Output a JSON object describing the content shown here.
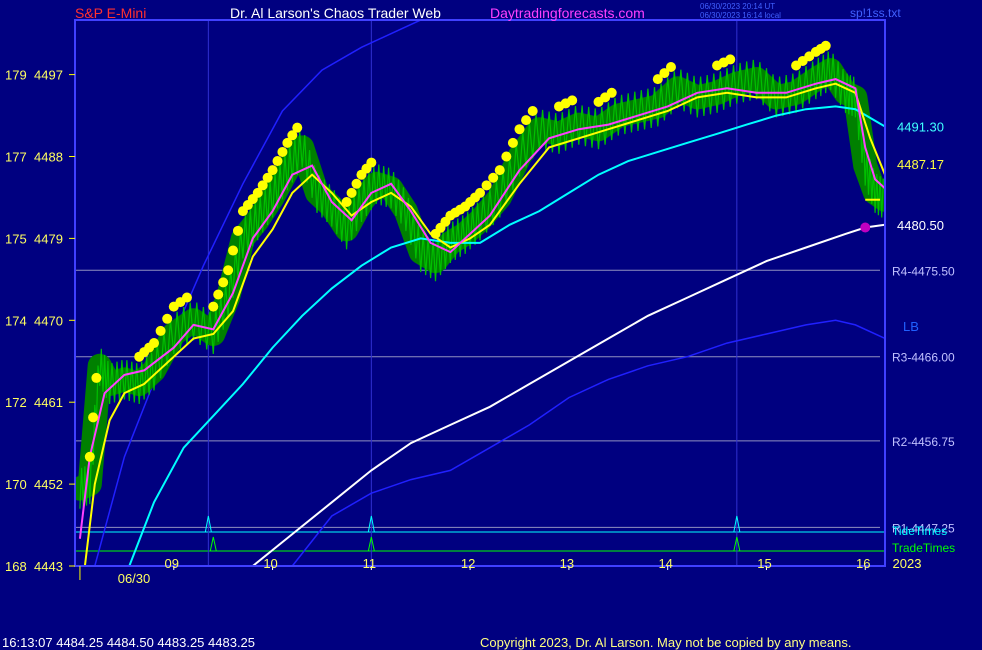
{
  "header": {
    "left": "S&P E-Mini",
    "center": "Dr. Al Larson's Chaos Trader Web",
    "site": "Daytradingforecasts.com",
    "stamp1": "06/30/2023 20:14 UT",
    "stamp2": "06/30/2023 16:14 local",
    "right": "sp!1ss.txt"
  },
  "footer": {
    "quote": "16:13:07  4484.25 4484.50 4483.25 4483.25",
    "copyright": "Copyright 2023, Dr. Al Larson. May not be copied by any means."
  },
  "colors": {
    "background": "#000080",
    "frame": "#4040ff",
    "price": "#00c000",
    "glow": "#008000",
    "ma_fast": "#ff40ff",
    "ma_slow": "#ffff00",
    "ma_cyan": "#00ffff",
    "ma_white": "#ffffff",
    "band": "#2020ff",
    "dots": "#ffff00",
    "pivot": "#c000c0"
  },
  "chart_data": {
    "type": "line",
    "title": "S&P E-Mini",
    "ylim": [
      4443,
      4503
    ],
    "y_ticks": [
      {
        "left": "168",
        "right": "4443",
        "value": 4443
      },
      {
        "left": "170",
        "right": "4452",
        "value": 4452
      },
      {
        "left": "172",
        "right": "4461",
        "value": 4461
      },
      {
        "left": "174",
        "right": "4470",
        "value": 4470
      },
      {
        "left": "175",
        "right": "4479",
        "value": 4479
      },
      {
        "left": "177",
        "right": "4488",
        "value": 4488
      },
      {
        "left": "179",
        "right": "4497",
        "value": 4497
      }
    ],
    "xlim": [
      8.0,
      16.2
    ],
    "x_ticks": [
      {
        "label": "09",
        "value": 9
      },
      {
        "label": "10",
        "value": 10
      },
      {
        "label": "11",
        "value": 11
      },
      {
        "label": "12",
        "value": 12
      },
      {
        "label": "13",
        "value": 13
      },
      {
        "label": "14",
        "value": 14
      },
      {
        "label": "15",
        "value": 15
      },
      {
        "label": "16",
        "value": 16
      }
    ],
    "date_label": "06/30",
    "year_label": "2023",
    "levels": [
      {
        "label": "R4-4475.50",
        "value": 4475.5
      },
      {
        "label": "R3-4466.00",
        "value": 4466.0
      },
      {
        "label": "R2-4456.75",
        "value": 4456.75
      },
      {
        "label": "R1-4447.25",
        "value": 4447.25
      }
    ],
    "value_labels": [
      {
        "label": "4491.30",
        "value": 4491.3,
        "series": "ma_cyan"
      },
      {
        "label": "4487.17",
        "value": 4487.17,
        "series": "ma_slow"
      },
      {
        "label": "4480.50",
        "value": 4480.5,
        "series": "ma_white"
      }
    ],
    "band_label": "LB",
    "legend": [
      "TideTimes",
      "TradeTimes"
    ],
    "tide_times": [
      9.35,
      11.0,
      14.7
    ],
    "trade_times": [
      9.4,
      11.0,
      14.7
    ],
    "price": {
      "x": [
        8.05,
        8.15,
        8.25,
        8.35,
        8.5,
        8.65,
        8.8,
        9.0,
        9.2,
        9.4,
        9.55,
        9.7,
        9.85,
        10.0,
        10.15,
        10.3,
        10.45,
        10.6,
        10.75,
        10.9,
        11.05,
        11.2,
        11.35,
        11.5,
        11.65,
        11.8,
        11.95,
        12.1,
        12.3,
        12.5,
        12.7,
        12.9,
        13.1,
        13.3,
        13.5,
        13.7,
        13.9,
        14.1,
        14.3,
        14.5,
        14.7,
        14.9,
        15.1,
        15.3,
        15.5,
        15.65,
        15.8,
        15.9,
        16.0,
        16.1,
        16.2
      ],
      "y": [
        4451.5,
        4452.0,
        4465.0,
        4463.0,
        4463.5,
        4463.0,
        4464.5,
        4468.5,
        4470.0,
        4468.5,
        4472.5,
        4479.0,
        4481.0,
        4483.5,
        4486.5,
        4489.0,
        4484.0,
        4482.5,
        4480.0,
        4483.0,
        4485.0,
        4484.5,
        4482.0,
        4477.5,
        4476.5,
        4478.5,
        4479.5,
        4481.0,
        4483.5,
        4488.0,
        4491.0,
        4490.5,
        4491.5,
        4491.0,
        4492.5,
        4493.0,
        4493.5,
        4495.5,
        4494.5,
        4495.0,
        4496.0,
        4496.5,
        4494.5,
        4495.0,
        4496.5,
        4497.5,
        4495.0,
        4494.5,
        4487.0,
        4484.0,
        4483.25
      ]
    },
    "series": [
      {
        "name": "ma_fast",
        "points": [
          [
            8.05,
            4446
          ],
          [
            8.15,
            4455
          ],
          [
            8.3,
            4462
          ],
          [
            8.5,
            4464
          ],
          [
            8.7,
            4464.5
          ],
          [
            9.0,
            4467
          ],
          [
            9.2,
            4469.5
          ],
          [
            9.4,
            4469
          ],
          [
            9.6,
            4473
          ],
          [
            9.8,
            4479
          ],
          [
            10.0,
            4482
          ],
          [
            10.2,
            4486
          ],
          [
            10.4,
            4487
          ],
          [
            10.6,
            4483
          ],
          [
            10.8,
            4481
          ],
          [
            11.0,
            4484
          ],
          [
            11.2,
            4485
          ],
          [
            11.4,
            4482
          ],
          [
            11.6,
            4478.5
          ],
          [
            11.8,
            4477.5
          ],
          [
            12.0,
            4479.5
          ],
          [
            12.2,
            4481.5
          ],
          [
            12.5,
            4486.5
          ],
          [
            12.8,
            4490
          ],
          [
            13.1,
            4491
          ],
          [
            13.4,
            4491.5
          ],
          [
            13.7,
            4492.5
          ],
          [
            14.0,
            4493.5
          ],
          [
            14.3,
            4495
          ],
          [
            14.6,
            4495.5
          ],
          [
            14.9,
            4495
          ],
          [
            15.2,
            4495
          ],
          [
            15.5,
            4496
          ],
          [
            15.7,
            4496.5
          ],
          [
            15.9,
            4495.5
          ],
          [
            16.0,
            4489
          ],
          [
            16.1,
            4485.5
          ],
          [
            16.2,
            4484.5
          ]
        ]
      },
      {
        "name": "ma_slow",
        "points": [
          [
            8.1,
            4443
          ],
          [
            8.2,
            4452
          ],
          [
            8.35,
            4459
          ],
          [
            8.5,
            4462
          ],
          [
            8.7,
            4463
          ],
          [
            9.0,
            4466
          ],
          [
            9.2,
            4468
          ],
          [
            9.4,
            4468.5
          ],
          [
            9.6,
            4471
          ],
          [
            9.8,
            4477
          ],
          [
            10.0,
            4480
          ],
          [
            10.2,
            4484
          ],
          [
            10.4,
            4486
          ],
          [
            10.6,
            4484
          ],
          [
            10.8,
            4481.5
          ],
          [
            11.0,
            4483
          ],
          [
            11.2,
            4484
          ],
          [
            11.4,
            4482.5
          ],
          [
            11.6,
            4479.5
          ],
          [
            11.8,
            4478
          ],
          [
            12.0,
            4479
          ],
          [
            12.2,
            4480.5
          ],
          [
            12.5,
            4485
          ],
          [
            12.8,
            4489
          ],
          [
            13.1,
            4490
          ],
          [
            13.4,
            4491
          ],
          [
            13.7,
            4492
          ],
          [
            14.0,
            4493
          ],
          [
            14.3,
            4494.5
          ],
          [
            14.6,
            4495
          ],
          [
            14.9,
            4494.5
          ],
          [
            15.2,
            4494.5
          ],
          [
            15.5,
            4495.5
          ],
          [
            15.7,
            4496
          ],
          [
            15.9,
            4495
          ],
          [
            16.05,
            4490
          ],
          [
            16.2,
            4486
          ]
        ]
      },
      {
        "name": "ma_cyan",
        "points": [
          [
            8.55,
            4443
          ],
          [
            8.8,
            4450
          ],
          [
            9.1,
            4456
          ],
          [
            9.4,
            4459.5
          ],
          [
            9.7,
            4463
          ],
          [
            10.0,
            4467
          ],
          [
            10.3,
            4470.5
          ],
          [
            10.6,
            4473.5
          ],
          [
            10.9,
            4476
          ],
          [
            11.2,
            4478
          ],
          [
            11.5,
            4479
          ],
          [
            11.8,
            4478.5
          ],
          [
            12.1,
            4478.5
          ],
          [
            12.4,
            4480.5
          ],
          [
            12.7,
            4482
          ],
          [
            13.0,
            4484
          ],
          [
            13.3,
            4486
          ],
          [
            13.6,
            4487.5
          ],
          [
            13.9,
            4488.5
          ],
          [
            14.2,
            4489.5
          ],
          [
            14.5,
            4490.5
          ],
          [
            14.8,
            4491.5
          ],
          [
            15.1,
            4492.5
          ],
          [
            15.4,
            4493.2
          ],
          [
            15.7,
            4493.5
          ],
          [
            15.9,
            4493.2
          ],
          [
            16.2,
            4491.3
          ]
        ]
      },
      {
        "name": "ma_white",
        "points": [
          [
            9.8,
            4443
          ],
          [
            10.2,
            4446.5
          ],
          [
            10.6,
            4450
          ],
          [
            11.0,
            4453.5
          ],
          [
            11.4,
            4456.5
          ],
          [
            11.8,
            4458.5
          ],
          [
            12.2,
            4460.5
          ],
          [
            12.6,
            4463
          ],
          [
            13.0,
            4465.5
          ],
          [
            13.4,
            4468
          ],
          [
            13.8,
            4470.5
          ],
          [
            14.2,
            4472.5
          ],
          [
            14.6,
            4474.5
          ],
          [
            15.0,
            4476.5
          ],
          [
            15.4,
            4478
          ],
          [
            15.8,
            4479.5
          ],
          [
            16.0,
            4480.2
          ],
          [
            16.2,
            4480.5
          ]
        ]
      },
      {
        "name": "band_upper",
        "points": [
          [
            8.2,
            4443
          ],
          [
            8.5,
            4455
          ],
          [
            8.9,
            4466
          ],
          [
            9.3,
            4476
          ],
          [
            9.7,
            4485
          ],
          [
            10.1,
            4493
          ],
          [
            10.5,
            4497.5
          ],
          [
            10.9,
            4500
          ],
          [
            11.3,
            4502
          ],
          [
            11.7,
            4504
          ],
          [
            12.0,
            4504
          ],
          [
            12.3,
            4505
          ],
          [
            12.6,
            4506
          ]
        ]
      },
      {
        "name": "band_lower",
        "points": [
          [
            10.2,
            4443
          ],
          [
            10.6,
            4448.5
          ],
          [
            11.0,
            4451
          ],
          [
            11.4,
            4452.5
          ],
          [
            11.8,
            4453.5
          ],
          [
            12.2,
            4456
          ],
          [
            12.6,
            4458.5
          ],
          [
            13.0,
            4461.5
          ],
          [
            13.4,
            4463.5
          ],
          [
            13.8,
            4465
          ],
          [
            14.2,
            4466
          ],
          [
            14.6,
            4467.5
          ],
          [
            15.0,
            4468.5
          ],
          [
            15.4,
            4469.5
          ],
          [
            15.7,
            4470
          ],
          [
            15.9,
            4469.5
          ],
          [
            16.2,
            4468
          ]
        ]
      }
    ]
  }
}
